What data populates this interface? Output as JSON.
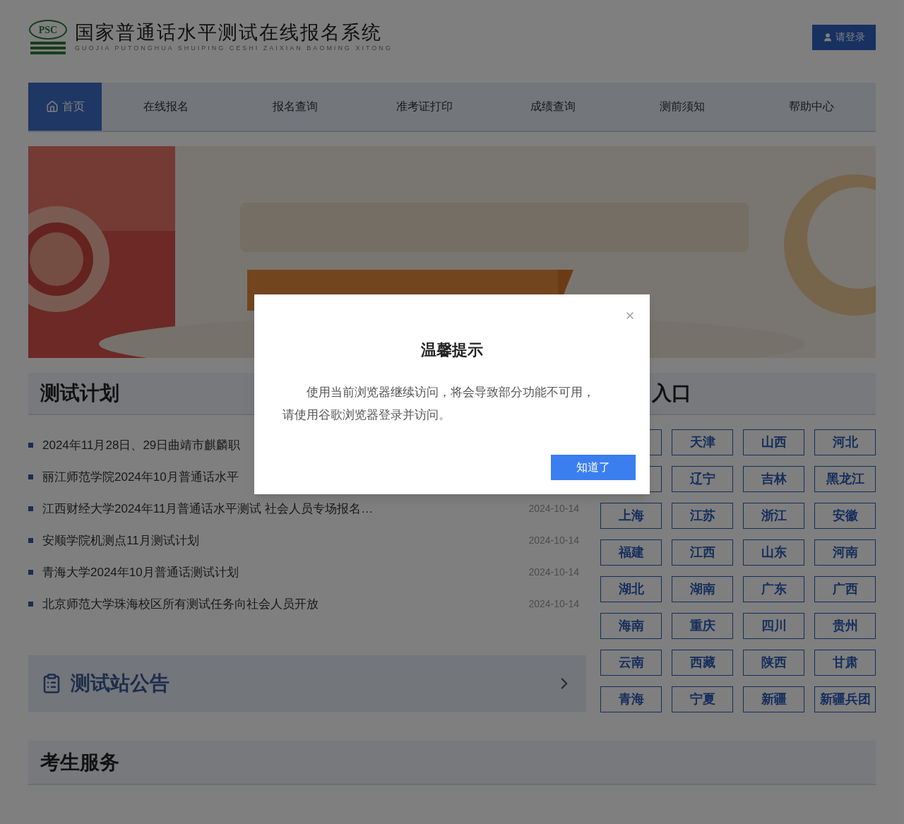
{
  "header": {
    "logo_text": "PSC",
    "title": "国家普通话水平测试在线报名系统",
    "subtitle": "GUOJIA PUTONGHUA SHUIPING CESHI ZAIXIAN BAOMING XITONG",
    "login_button": "请登录"
  },
  "nav": [
    {
      "label": "首页",
      "kind": "home",
      "selected": true
    },
    {
      "label": "在线报名",
      "kind": "link",
      "selected": false
    },
    {
      "label": "报名查询",
      "kind": "link",
      "selected": false
    },
    {
      "label": "准考证打印",
      "kind": "link",
      "selected": false
    },
    {
      "label": "成绩查询",
      "kind": "link",
      "selected": false
    },
    {
      "label": "测前须知",
      "kind": "link",
      "selected": false
    },
    {
      "label": "帮助中心",
      "kind": "link",
      "selected": false
    }
  ],
  "test_plan": {
    "title": "测试计划",
    "items": [
      {
        "title": "2024年11月28日、29日曲靖市麒麟职"
      },
      {
        "title": "丽江师范学院2024年10月普通话水平"
      },
      {
        "title": "江西财经大学2024年11月普通话水平测试 社会人员专场报名…",
        "date": "2024-10-14"
      },
      {
        "title": "安顺学院机测点11月测试计划",
        "date": "2024-10-14"
      },
      {
        "title": "青海大学2024年10月普通话测试计划",
        "date": "2024-10-14"
      },
      {
        "title": "北京师范大学珠海校区所有测试任务向社会人员开放",
        "date": "2024-10-14"
      }
    ]
  },
  "notice_card": {
    "title": "测试站公告"
  },
  "province_entry": {
    "title": "入口",
    "cells": [
      {
        "kind": "covered"
      },
      {
        "kind": "province",
        "label": "天津"
      },
      {
        "kind": "province",
        "label": "山西"
      },
      {
        "kind": "province",
        "label": "河北"
      },
      {
        "kind": "covered"
      },
      {
        "kind": "province",
        "label": "辽宁"
      },
      {
        "kind": "province",
        "label": "吉林"
      },
      {
        "kind": "province",
        "label": "黑龙江"
      },
      {
        "kind": "province",
        "label": "上海"
      },
      {
        "kind": "province",
        "label": "江苏"
      },
      {
        "kind": "province",
        "label": "浙江"
      },
      {
        "kind": "province",
        "label": "安徽"
      },
      {
        "kind": "province",
        "label": "福建"
      },
      {
        "kind": "province",
        "label": "江西"
      },
      {
        "kind": "province",
        "label": "山东"
      },
      {
        "kind": "province",
        "label": "河南"
      },
      {
        "kind": "province",
        "label": "湖北"
      },
      {
        "kind": "province",
        "label": "湖南"
      },
      {
        "kind": "province",
        "label": "广东"
      },
      {
        "kind": "province",
        "label": "广西"
      },
      {
        "kind": "province",
        "label": "海南"
      },
      {
        "kind": "province",
        "label": "重庆"
      },
      {
        "kind": "province",
        "label": "四川"
      },
      {
        "kind": "province",
        "label": "贵州"
      },
      {
        "kind": "province",
        "label": "云南"
      },
      {
        "kind": "province",
        "label": "西藏"
      },
      {
        "kind": "province",
        "label": "陕西"
      },
      {
        "kind": "province",
        "label": "甘肃"
      },
      {
        "kind": "province",
        "label": "青海"
      },
      {
        "kind": "province",
        "label": "宁夏"
      },
      {
        "kind": "province",
        "label": "新疆"
      },
      {
        "kind": "province",
        "label": "新疆兵团"
      }
    ]
  },
  "services": {
    "title": "考生服务"
  },
  "dialog": {
    "title": "温馨提示",
    "body": "使用当前浏览器继续访问，将会导致部分功能不可用，请使用谷歌浏览器登录并访问。",
    "button": "知道了"
  }
}
